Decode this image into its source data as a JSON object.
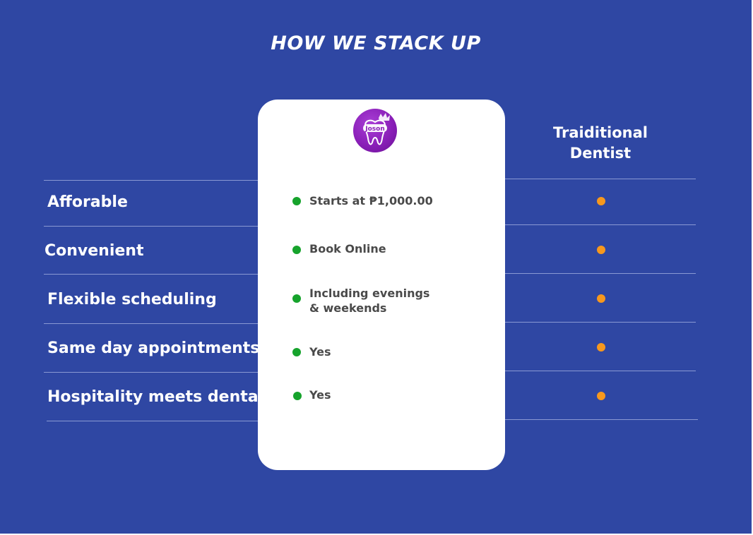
{
  "title": "HOW WE STACK UP",
  "logo": {
    "icon": "tooth-crown-logo",
    "text": "Joson",
    "color": "#8a1fb8"
  },
  "competitor": {
    "header": "Traiditional\nDentist"
  },
  "colors": {
    "background": "#2f47a3",
    "card": "#ffffff",
    "yes_dot": "#16a32c",
    "competitor_dot": "#f7981d"
  },
  "rows": [
    {
      "feature": "Afforable",
      "value": "Starts at ₱1,000.00"
    },
    {
      "feature": "Convenient",
      "value": "Book Online"
    },
    {
      "feature": "Flexible scheduling",
      "value": "Including evenings\n& weekends"
    },
    {
      "feature": "Same day appointments",
      "value": "Yes"
    },
    {
      "feature": "Hospitality meets dental",
      "value": "Yes"
    }
  ]
}
